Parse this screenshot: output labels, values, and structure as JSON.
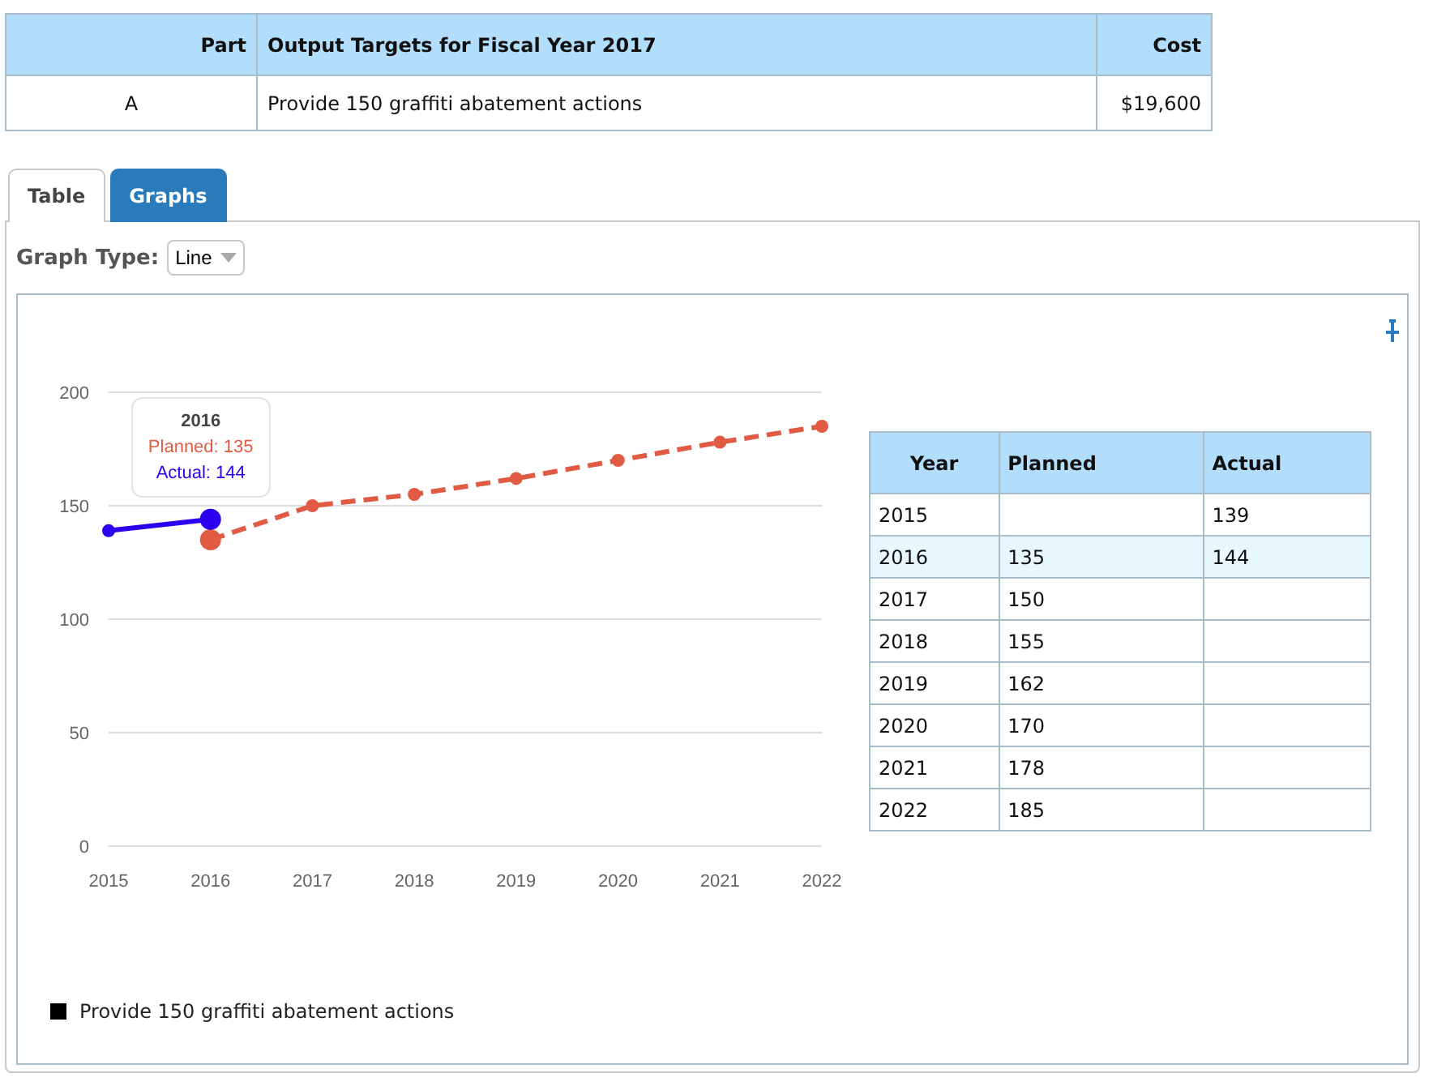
{
  "summary_table": {
    "columns": [
      "Part",
      "Output Targets for Fiscal Year 2017",
      "Cost"
    ],
    "rows": [
      [
        "A",
        "Provide 150 graffiti abatement actions",
        "$19,600"
      ]
    ]
  },
  "tabs": [
    {
      "label": "Table",
      "selected": false
    },
    {
      "label": "Graphs",
      "selected": true
    }
  ],
  "graph_type": {
    "label": "Graph Type:",
    "value": "Line"
  },
  "graph": {
    "chart_data": {
      "type": "line",
      "categories": [
        "2015",
        "2016",
        "2017",
        "2018",
        "2019",
        "2020",
        "2021",
        "2022"
      ],
      "ylim": [
        0,
        200
      ],
      "yticks": [
        0,
        50,
        100,
        150,
        200
      ],
      "grid": true,
      "series": [
        {
          "color": "#e05a44",
          "line_style": "dashed",
          "marker": "circle",
          "values": [
            null,
            135,
            150,
            155,
            162,
            170,
            178,
            185
          ]
        },
        {
          "color": "#2b00f0",
          "line_style": "solid",
          "marker": "circle",
          "values": [
            139,
            144,
            null,
            null,
            null,
            null,
            null,
            null
          ]
        }
      ]
    },
    "tooltip": {
      "title": "2016",
      "lines": [
        "Planned: 135",
        "Actual: 144"
      ]
    },
    "data_table": {
      "columns": [
        "Year",
        "Planned",
        "Actual"
      ],
      "rows": [
        {
          "cells": [
            "2015",
            "",
            "139"
          ],
          "highlighted": false
        },
        {
          "cells": [
            "2016",
            "135",
            "144"
          ],
          "highlighted": true
        },
        {
          "cells": [
            "2017",
            "150",
            ""
          ],
          "highlighted": false
        },
        {
          "cells": [
            "2018",
            "155",
            ""
          ],
          "highlighted": false
        },
        {
          "cells": [
            "2019",
            "162",
            ""
          ],
          "highlighted": false
        },
        {
          "cells": [
            "2020",
            "170",
            ""
          ],
          "highlighted": false
        },
        {
          "cells": [
            "2021",
            "178",
            ""
          ],
          "highlighted": false
        },
        {
          "cells": [
            "2022",
            "185",
            ""
          ],
          "highlighted": false
        }
      ]
    },
    "legend": "Provide 150 graffiti abatement actions"
  }
}
